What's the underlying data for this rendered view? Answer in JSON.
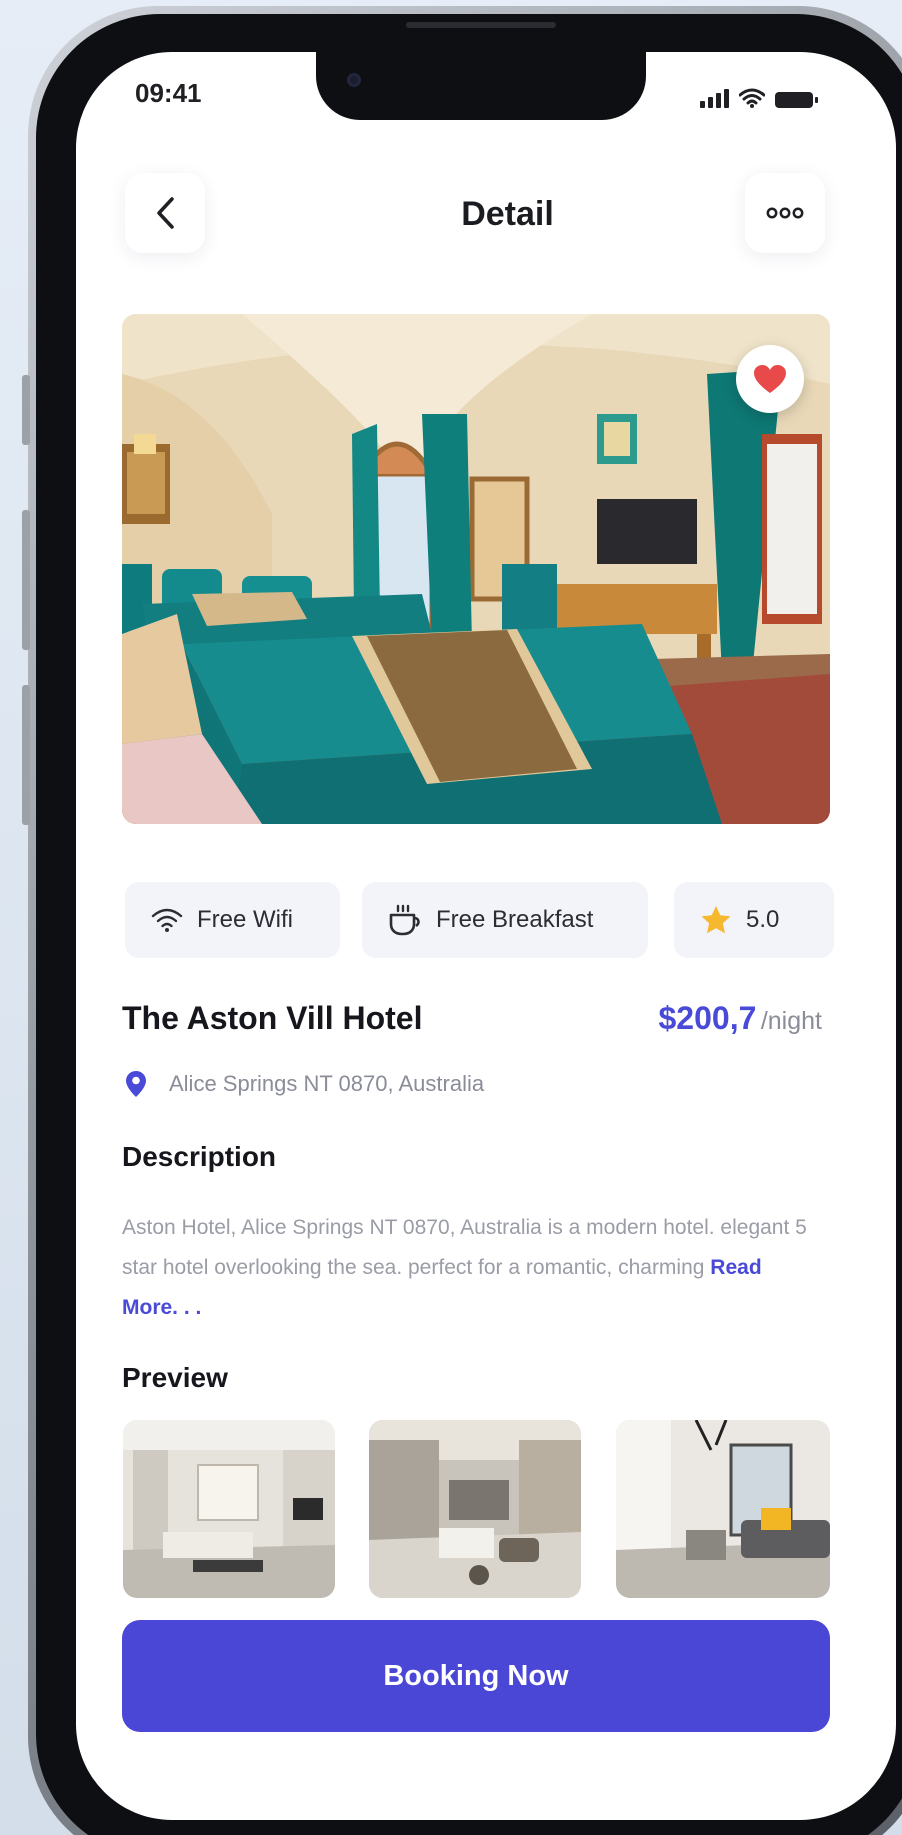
{
  "status_bar": {
    "time": "09:41",
    "icons": [
      "signal-icon",
      "wifi-icon",
      "battery-icon"
    ]
  },
  "header": {
    "title": "Detail",
    "back_icon": "chevron-left-icon",
    "more_icon": "more-dots-icon"
  },
  "hero": {
    "favorite_icon": "heart-icon",
    "favorite_color": "#e84a4a",
    "favorited": true
  },
  "amenities": [
    {
      "icon": "wifi-icon",
      "label": "Free Wifi"
    },
    {
      "icon": "coffee-cup-icon",
      "label": "Free Breakfast"
    },
    {
      "icon": "star-icon",
      "label": "5.0"
    }
  ],
  "hotel": {
    "name": "The Aston Vill Hotel",
    "price": "$200,7",
    "price_unit": "/night",
    "location": "Alice Springs NT 0870, Australia",
    "location_icon": "map-pin-icon"
  },
  "description": {
    "title": "Description",
    "text": "Aston Hotel, Alice Springs NT 0870, Australia is a modern hotel. elegant 5 star hotel overlooking the sea. perfect for a romantic, charming ",
    "read_more": "Read More. . ."
  },
  "preview": {
    "title": "Preview",
    "count": 3
  },
  "cta": {
    "label": "Booking Now"
  },
  "colors": {
    "accent": "#4b47d6",
    "price": "#4a4ad8",
    "star": "#f5b82e",
    "pin": "#4a4ad8"
  }
}
